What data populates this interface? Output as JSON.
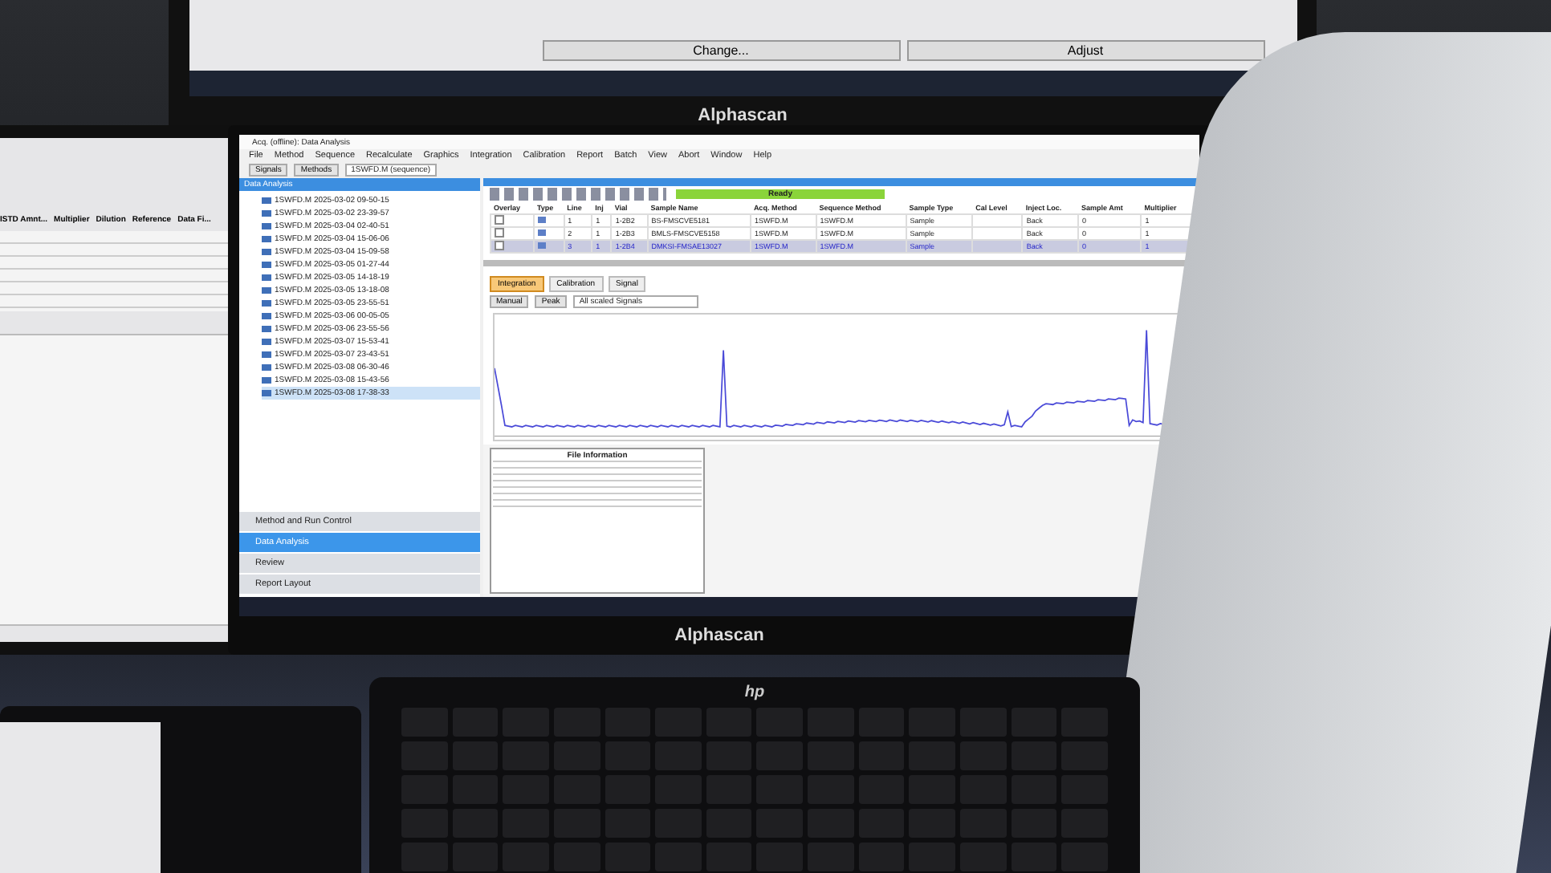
{
  "top_monitor": {
    "buttons": [
      "Change...",
      "Adjust"
    ],
    "brand": "Alphascan"
  },
  "left_monitor": {
    "columns": [
      "ISTD Amnt...",
      "Multiplier",
      "Dilution",
      "Reference",
      "Data Fi..."
    ]
  },
  "main_monitor": {
    "brand": "Alphascan",
    "window": {
      "title": "Acq. (offline): Data Analysis",
      "menu": [
        "File",
        "Method",
        "Sequence",
        "Recalculate",
        "Graphics",
        "Integration",
        "Calibration",
        "Report",
        "Batch",
        "View",
        "Abort",
        "Window",
        "Help"
      ],
      "toolbar": {
        "buttons": [
          "Signals",
          "Methods"
        ],
        "sequence": "1SWFD.M (sequence)"
      },
      "left_panel": {
        "title": "Data Analysis",
        "tree": [
          {
            "label": "1SWFD.M 2025-03-02 09-50-15",
            "selected": false
          },
          {
            "label": "1SWFD.M 2025-03-02 23-39-57",
            "selected": false
          },
          {
            "label": "1SWFD.M 2025-03-04 02-40-51",
            "selected": false
          },
          {
            "label": "1SWFD.M 2025-03-04 15-06-06",
            "selected": false
          },
          {
            "label": "1SWFD.M 2025-03-04 15-09-58",
            "selected": false
          },
          {
            "label": "1SWFD.M 2025-03-05 01-27-44",
            "selected": false
          },
          {
            "label": "1SWFD.M 2025-03-05 14-18-19",
            "selected": false
          },
          {
            "label": "1SWFD.M 2025-03-05 13-18-08",
            "selected": false
          },
          {
            "label": "1SWFD.M 2025-03-05 23-55-51",
            "selected": false
          },
          {
            "label": "1SWFD.M 2025-03-06 00-05-05",
            "selected": false
          },
          {
            "label": "1SWFD.M 2025-03-06 23-55-56",
            "selected": false
          },
          {
            "label": "1SWFD.M 2025-03-07 15-53-41",
            "selected": false
          },
          {
            "label": "1SWFD.M 2025-03-07 23-43-51",
            "selected": false
          },
          {
            "label": "1SWFD.M 2025-03-08 06-30-46",
            "selected": false
          },
          {
            "label": "1SWFD.M 2025-03-08 15-43-56",
            "selected": false
          },
          {
            "label": "1SWFD.M 2025-03-08 17-38-33",
            "selected": true
          }
        ],
        "nav": [
          {
            "label": "Method and Run Control",
            "selected": false
          },
          {
            "label": "Data Analysis",
            "selected": true
          },
          {
            "label": "Review",
            "selected": false
          },
          {
            "label": "Report Layout",
            "selected": false
          }
        ]
      },
      "status": "Ready",
      "table": {
        "columns": [
          "Overlay",
          "Type",
          "Line",
          "Inj",
          "Vial",
          "Sample Name",
          "Acq. Method",
          "Sequence Method",
          "Sample Type",
          "Cal Level",
          "Inject Loc.",
          "Sample Amt",
          "Multiplier"
        ],
        "rows": [
          {
            "selected": false,
            "cells": [
              "",
              "",
              "1",
              "1",
              "1-2B2",
              "BS-FMSCVE5181",
              "1SWFD.M",
              "1SWFD.M",
              "Sample",
              "",
              "Back",
              "0",
              "1"
            ]
          },
          {
            "selected": false,
            "cells": [
              "",
              "",
              "2",
              "1",
              "1-2B3",
              "BMLS-FMSCVE5158",
              "1SWFD.M",
              "1SWFD.M",
              "Sample",
              "",
              "Back",
              "0",
              "1"
            ]
          },
          {
            "selected": true,
            "cells": [
              "",
              "",
              "3",
              "1",
              "1-2B4",
              "DMKSI-FMSAE13027",
              "1SWFD.M",
              "1SWFD.M",
              "Sample",
              "",
              "Back",
              "0",
              "1"
            ]
          }
        ]
      },
      "tabs": [
        {
          "label": "Integration",
          "selected": true
        },
        {
          "label": "Calibration",
          "selected": false
        },
        {
          "label": "Signal",
          "selected": false
        }
      ],
      "signal_toolbar": {
        "buttons": [
          "Manual",
          "Peak"
        ],
        "signal_select": "All scaled Signals"
      },
      "file_info": {
        "title": "File Information"
      }
    }
  },
  "keyboard": {
    "brand": "hp"
  }
}
